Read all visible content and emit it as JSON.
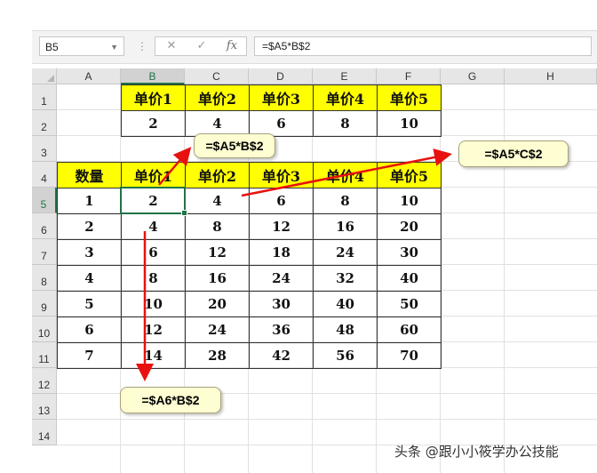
{
  "formula_bar": {
    "name_box": "B5",
    "cancel_icon": "✕",
    "enter_icon": "✓",
    "fx_icon": "fx",
    "formula": "=$A5*B$2"
  },
  "columns": [
    "A",
    "B",
    "C",
    "D",
    "E",
    "F",
    "G",
    "H"
  ],
  "rows": [
    "1",
    "2",
    "3",
    "4",
    "5",
    "6",
    "7",
    "8",
    "9",
    "10",
    "11",
    "12",
    "13",
    "14"
  ],
  "selected": {
    "column": "B",
    "row": "5"
  },
  "table1": {
    "headers": [
      "单价1",
      "单价2",
      "单价3",
      "单价4",
      "单价5"
    ],
    "values": [
      "2",
      "4",
      "6",
      "8",
      "10"
    ]
  },
  "table2": {
    "corner": "数量",
    "headers": [
      "单价1",
      "单价2",
      "单价3",
      "单价4",
      "单价5"
    ],
    "rows": [
      {
        "qty": "1",
        "cells": [
          "2",
          "4",
          "6",
          "8",
          "10"
        ]
      },
      {
        "qty": "2",
        "cells": [
          "4",
          "8",
          "12",
          "16",
          "20"
        ]
      },
      {
        "qty": "3",
        "cells": [
          "6",
          "12",
          "18",
          "24",
          "30"
        ]
      },
      {
        "qty": "4",
        "cells": [
          "8",
          "16",
          "24",
          "32",
          "40"
        ]
      },
      {
        "qty": "5",
        "cells": [
          "10",
          "20",
          "30",
          "40",
          "50"
        ]
      },
      {
        "qty": "6",
        "cells": [
          "12",
          "24",
          "36",
          "48",
          "60"
        ]
      },
      {
        "qty": "7",
        "cells": [
          "14",
          "28",
          "42",
          "56",
          "70"
        ]
      }
    ]
  },
  "callouts": [
    "=$A5*B$2",
    "=$A5*C$2",
    "=$A6*B$2"
  ],
  "colors": {
    "header_fill": "#ffff00",
    "selection": "#217346",
    "arrow": "#e8110f",
    "callout_fill": "#fffdd2"
  },
  "watermark": "头条 @跟小小筱学办公技能"
}
